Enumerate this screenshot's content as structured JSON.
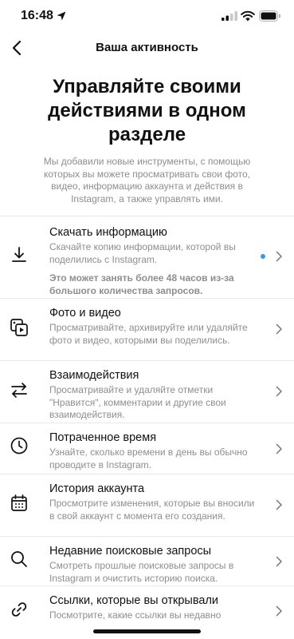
{
  "status": {
    "time": "16:48"
  },
  "nav": {
    "title": "Ваша активность"
  },
  "hero": {
    "title": "Управляйте своими действиями в одном разделе",
    "description": "Мы добавили новые инструменты, с помощью которых вы можете просматривать свои фото, видео, информацию аккаунта и действия в Instagram, а также управлять ими."
  },
  "items": [
    {
      "title": "Скачать информацию",
      "description": "Скачайте копию информации, которой вы поделились с Instagram.",
      "note": "Это может занять более 48 часов из-за большого количества запросов.",
      "icon": "download-icon",
      "has_dot": true
    },
    {
      "title": "Фото и видео",
      "description": "Просматривайте, архивируйте или удаляйте фото и видео, которыми вы поделились.",
      "icon": "photos-videos-icon"
    },
    {
      "title": "Взаимодействия",
      "description": "Просматривайте и удаляйте отметки \"Нравится\", комментарии и другие свои взаимодействия.",
      "icon": "interactions-icon"
    },
    {
      "title": "Потраченное время",
      "description": "Узнайте, сколько времени в день вы обычно проводите в Instagram.",
      "icon": "clock-icon"
    },
    {
      "title": "История аккаунта",
      "description": "Просмотрите изменения, которые вы вносили в свой аккаунт с момента его создания.",
      "icon": "calendar-icon"
    },
    {
      "title": "Недавние поисковые запросы",
      "description": "Смотреть прошлые поисковые запросы в Instagram и очистить историю поиска.",
      "icon": "search-icon"
    },
    {
      "title": "Ссылки, которые вы открывали",
      "description": "Посмотрите, какие ссылки вы недавно",
      "icon": "link-icon"
    }
  ],
  "colors": {
    "dot": "#3897f0",
    "text": "#111111",
    "secondary": "#8e8e8e",
    "divider": "#e8e8e8"
  }
}
